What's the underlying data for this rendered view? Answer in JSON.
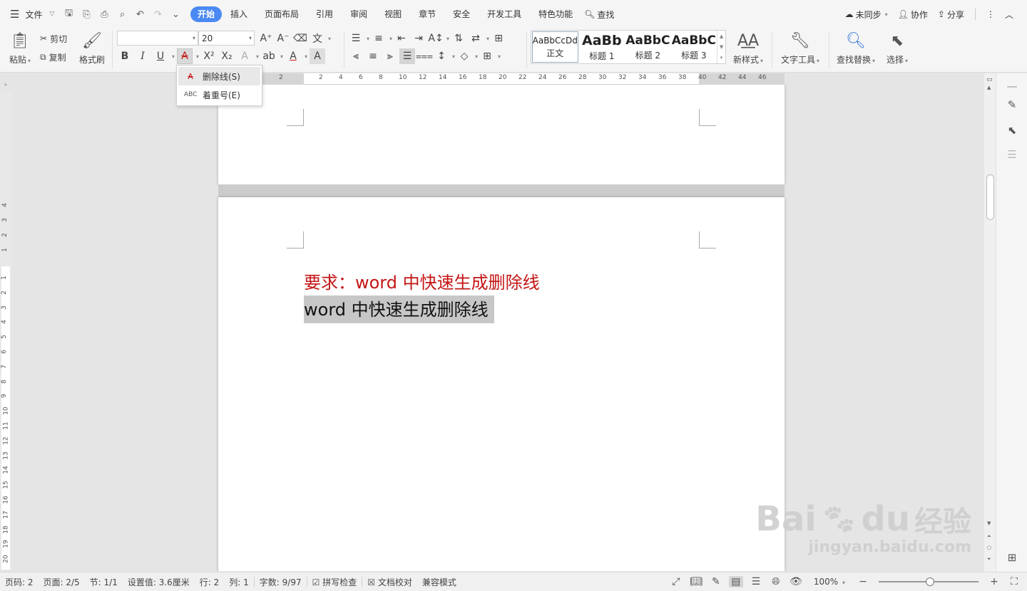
{
  "menubar": {
    "file_label": "文件",
    "tabs": [
      "开始",
      "插入",
      "页面布局",
      "引用",
      "审阅",
      "视图",
      "章节",
      "安全",
      "开发工具",
      "特色功能"
    ],
    "active_tab": "开始",
    "find_label": "查找",
    "sync_label": "未同步",
    "collab_label": "协作",
    "share_label": "分享"
  },
  "ribbon": {
    "paste_label": "粘贴",
    "cut_label": "剪切",
    "copy_label": "复制",
    "format_painter_label": "格式刷",
    "font_name": "",
    "font_size": "20",
    "styles": [
      {
        "preview": "AaBbCcDd",
        "name": "正文"
      },
      {
        "preview": "AaBb",
        "name": "标题 1"
      },
      {
        "preview": "AaBbC",
        "name": "标题 2"
      },
      {
        "preview": "AaBbC",
        "name": "标题 3"
      }
    ],
    "new_style_label": "新样式",
    "text_tools_label": "文字工具",
    "find_replace_label": "查找替换",
    "select_label": "选择"
  },
  "strike_menu": {
    "items": [
      {
        "label": "删除线(S)",
        "icon": "strikethrough-icon"
      },
      {
        "label": "着重号(E)",
        "icon": "emphasis-dot-icon"
      }
    ]
  },
  "ruler": {
    "h_ticks": [
      "4",
      "2",
      "2",
      "4",
      "6",
      "8",
      "10",
      "12",
      "14",
      "16",
      "18",
      "20",
      "22",
      "24",
      "26",
      "28",
      "30",
      "32",
      "34",
      "36",
      "38",
      "40",
      "42",
      "44",
      "46"
    ],
    "v_ticks_top": [
      "4",
      "3",
      "2",
      "1"
    ],
    "v_ticks": [
      "1",
      "2",
      "3",
      "4",
      "5",
      "6",
      "7",
      "8",
      "9",
      "10",
      "11",
      "12",
      "13",
      "14",
      "15",
      "16",
      "17",
      "18",
      "19",
      "20"
    ]
  },
  "document": {
    "line1": "要求：word 中快速生成删除线",
    "line2": "word 中快速生成删除线"
  },
  "watermark": {
    "brand": "Bai",
    "brand_tail": "du",
    "brand_cn": "经验",
    "url": "jingyan.baidu.com"
  },
  "status": {
    "page": "页码: 2",
    "pages": "页面: 2/5",
    "section": "节: 1/1",
    "setting": "设置值: 3.6厘米",
    "row": "行: 2",
    "col": "列: 1",
    "words": "字数: 9/97",
    "spell": "拼写检查",
    "proof": "文档校对",
    "compat": "兼容模式",
    "zoom": "100%"
  },
  "colors": {
    "accent": "#4a89f3",
    "red_text": "#c41515",
    "selection": "#c7c7c7"
  }
}
